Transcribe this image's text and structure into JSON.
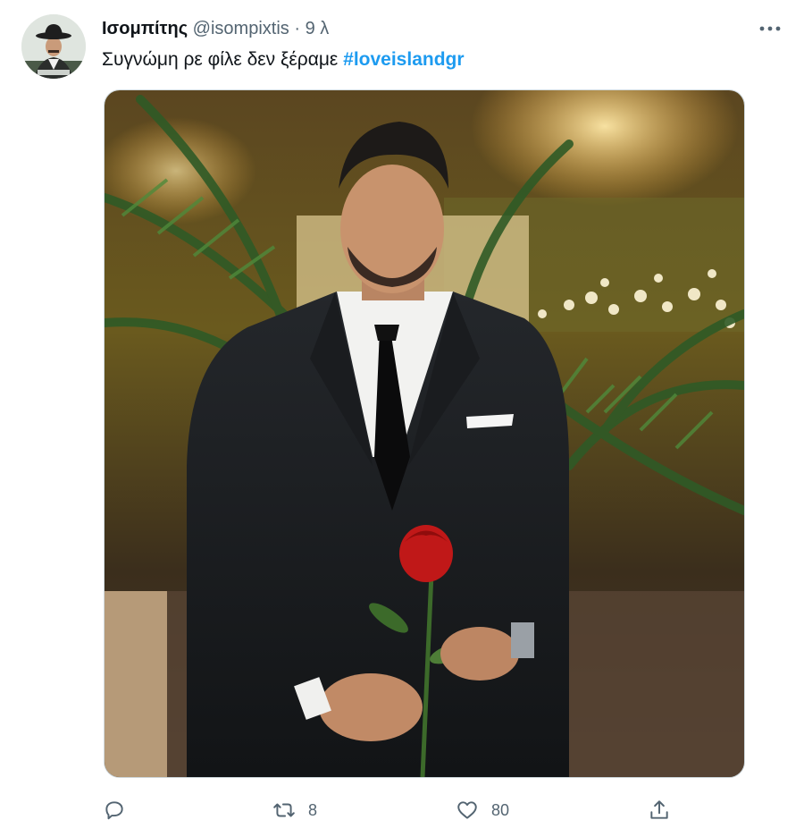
{
  "tweet": {
    "display_name": "Ισομπίτης",
    "handle": "@isompixtis",
    "separator": "·",
    "time": "9 λ",
    "text": "Συγνώμη ρε φίλε δεν ξέραμε",
    "hashtag": "#loveislandgr"
  },
  "icons": {
    "more": "more-horizontal-icon",
    "reply": "reply-icon",
    "retweet": "retweet-icon",
    "like": "heart-icon",
    "share": "share-icon"
  },
  "actions": {
    "retweets": "8",
    "likes": "80"
  },
  "colors": {
    "accent": "#1d9bf0",
    "secondary_text": "#536471",
    "primary_text": "#0f1419"
  }
}
